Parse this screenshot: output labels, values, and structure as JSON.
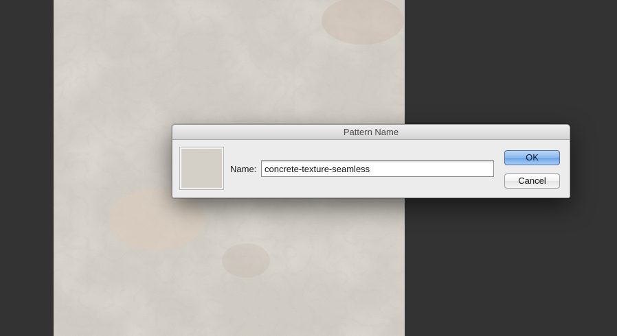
{
  "dialog": {
    "title": "Pattern Name",
    "name_label": "Name:",
    "name_value": "concrete-texture-seamless",
    "ok_label": "OK",
    "cancel_label": "Cancel"
  },
  "colors": {
    "workspace_background": "#333333",
    "document_texture": "#d8d4cc",
    "dialog_background": "#ececec",
    "ok_button_accent": "#8db8ee"
  },
  "document": {
    "content": "concrete-texture"
  }
}
